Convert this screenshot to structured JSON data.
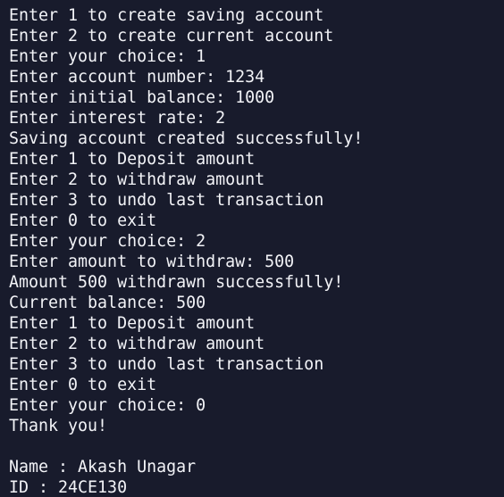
{
  "terminal": {
    "lines": [
      "Enter 1 to create saving account",
      "Enter 2 to create current account",
      "Enter your choice: 1",
      "Enter account number: 1234",
      "Enter initial balance: 1000",
      "Enter interest rate: 2",
      "Saving account created successfully!",
      "Enter 1 to Deposit amount",
      "Enter 2 to withdraw amount",
      "Enter 3 to undo last transaction",
      "Enter 0 to exit",
      "Enter your choice: 2",
      "Enter amount to withdraw: 500",
      "Amount 500 withdrawn successfully!",
      "Current balance: 500",
      "Enter 1 to Deposit amount",
      "Enter 2 to withdraw amount",
      "Enter 3 to undo last transaction",
      "Enter 0 to exit",
      "Enter your choice: 0",
      "Thank you!",
      "",
      "Name : Akash Unagar",
      "ID : 24CE130"
    ]
  }
}
